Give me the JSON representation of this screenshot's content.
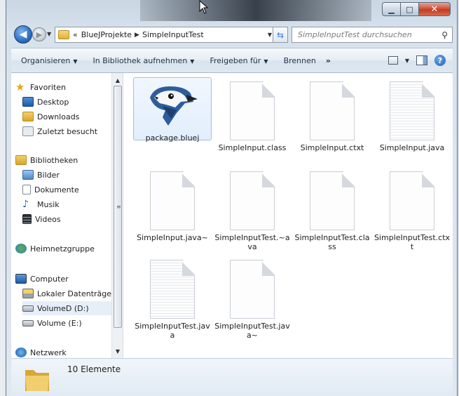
{
  "window": {
    "minimize_glyph": "▁",
    "maximize_glyph": "□",
    "close_glyph": "✕"
  },
  "address": {
    "overflow": "«",
    "crumbs": [
      "BlueJProjekte",
      "SimpleInputTest"
    ],
    "separator": "▶"
  },
  "search": {
    "placeholder": "SimpleInputTest durchsuchen"
  },
  "toolbar": {
    "organize": "Organisieren",
    "library": "In Bibliothek aufnehmen",
    "share": "Freigeben für",
    "burn": "Brennen",
    "more": "»"
  },
  "navpane": {
    "favorites": "Favoriten",
    "desktop": "Desktop",
    "downloads": "Downloads",
    "recent": "Zuletzt besucht",
    "libraries": "Bibliotheken",
    "pictures": "Bilder",
    "documents": "Dokumente",
    "music": "Musik",
    "videos": "Videos",
    "homegroup": "Heimnetzgruppe",
    "computer": "Computer",
    "local_disk": "Lokaler Datenträger",
    "volume_d": "VolumeD (D:)",
    "volume_e": "Volume (E:)",
    "network": "Netzwerk"
  },
  "files": [
    {
      "name": "package.bluej",
      "icon": "bluej-bird-icon"
    },
    {
      "name": "SimpleInput.class",
      "icon": "blank-file-icon"
    },
    {
      "name": "SimpleInput.ctxt",
      "icon": "blank-file-icon"
    },
    {
      "name": "SimpleInput.java",
      "icon": "text-file-icon"
    },
    {
      "name": "SimpleInput.java~",
      "icon": "blank-file-icon"
    },
    {
      "name": "SimpleInputTest.~ava",
      "icon": "blank-file-icon"
    },
    {
      "name": "SimpleInputTest.class",
      "icon": "blank-file-icon"
    },
    {
      "name": "SimpleInputTest.ctxt",
      "icon": "blank-file-icon"
    },
    {
      "name": "SimpleInputTest.java",
      "icon": "text-file-icon"
    },
    {
      "name": "SimpleInputTest.java~",
      "icon": "blank-file-icon"
    }
  ],
  "details": {
    "count": "10 Elemente"
  },
  "colors": {
    "accent": "#2f6fc0",
    "selection": "#e2eefc"
  }
}
